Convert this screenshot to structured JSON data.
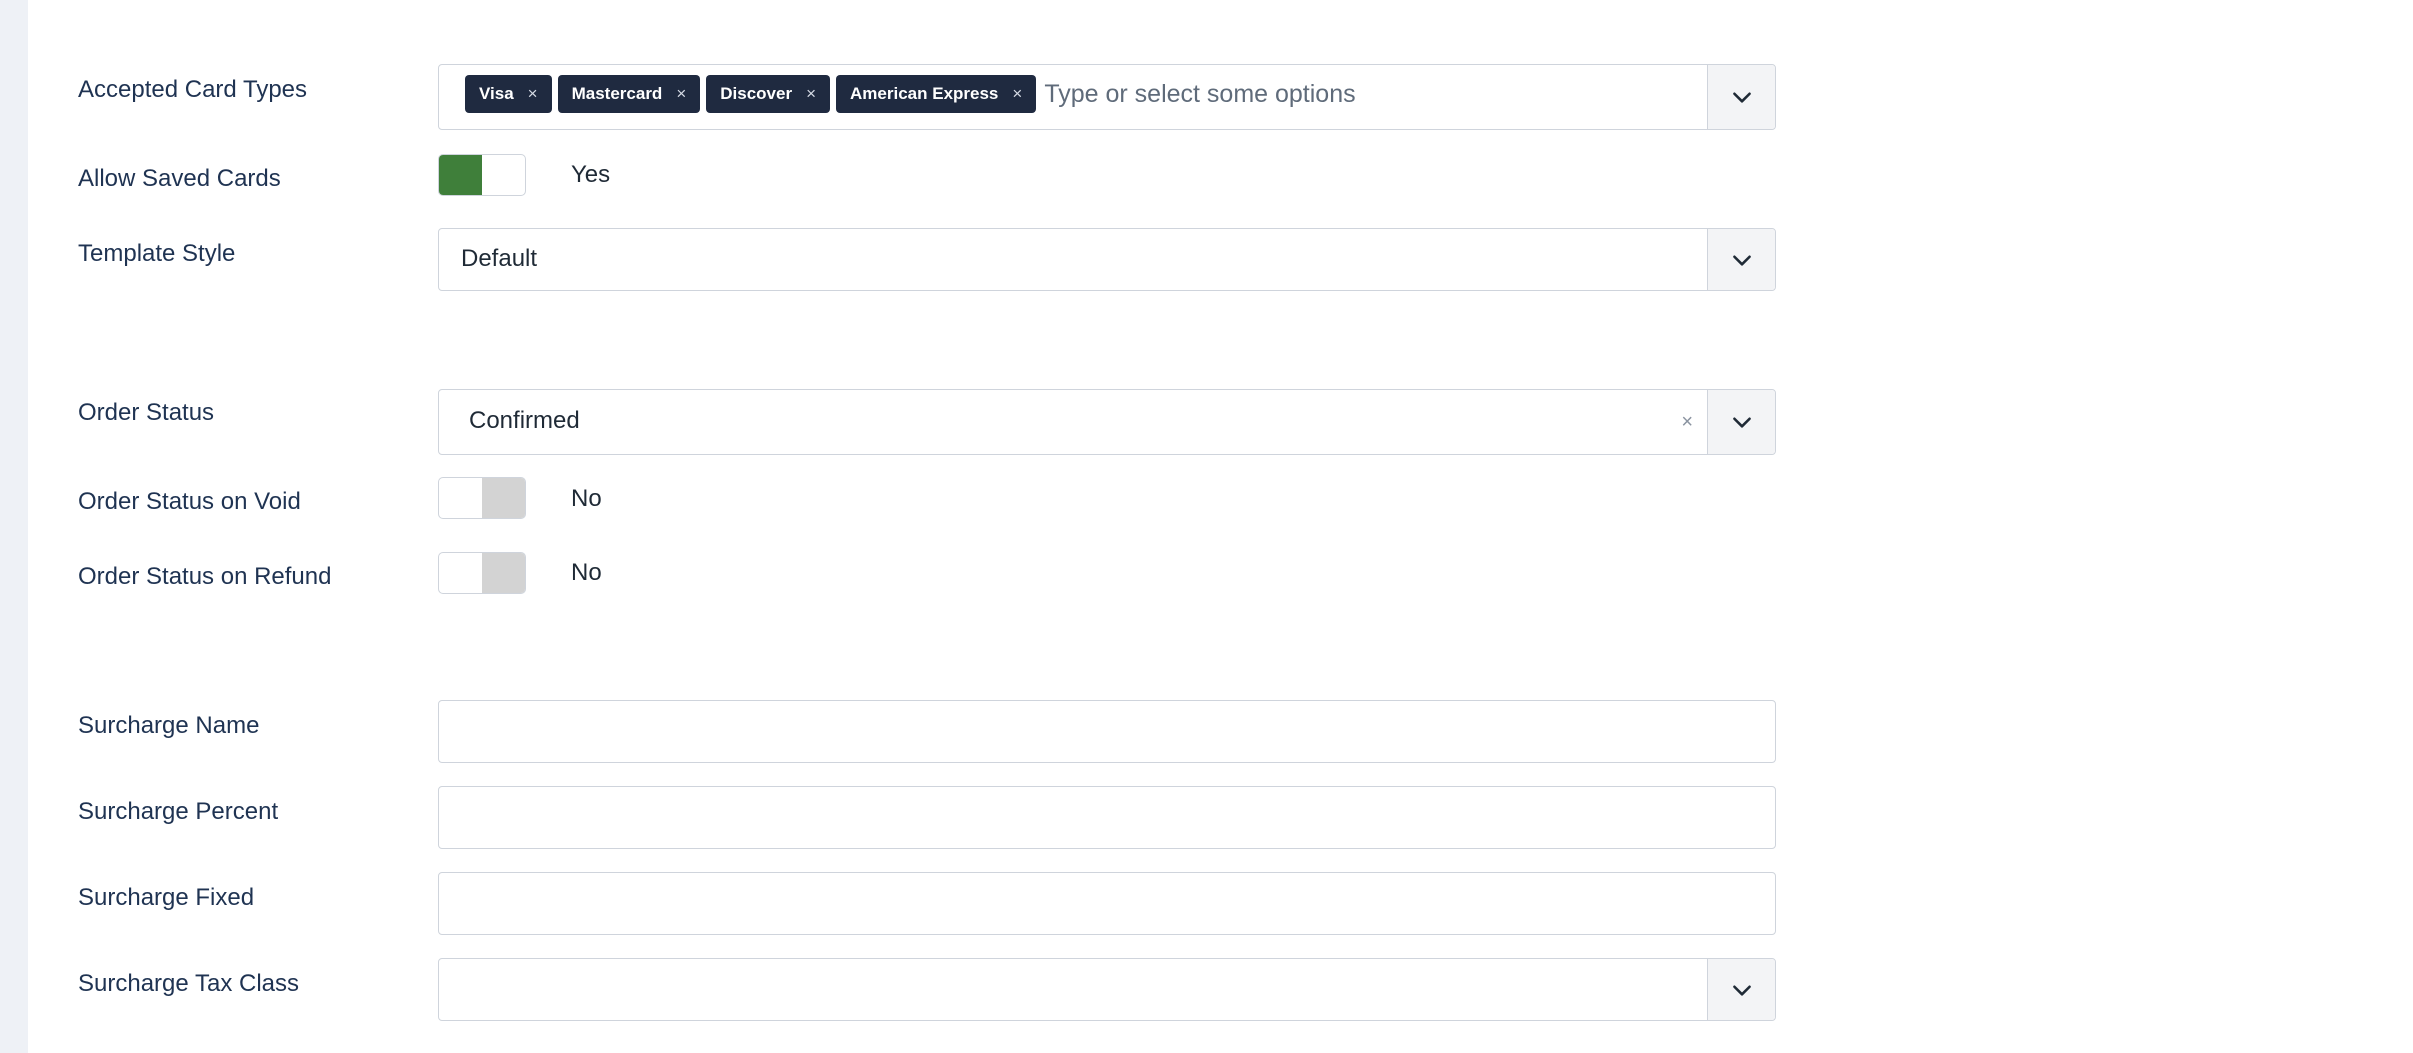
{
  "colors": {
    "page_bg": "#eef1f6",
    "panel_bg": "#ffffff",
    "tag_bg": "#1f2a40",
    "toggle_on": "#3f7f3a",
    "toggle_off": "#d3d3d3"
  },
  "accepted_card_types": {
    "label": "Accepted Card Types",
    "tags": [
      {
        "label": "Visa",
        "remove": "×"
      },
      {
        "label": "Mastercard",
        "remove": "×"
      },
      {
        "label": "Discover",
        "remove": "×"
      },
      {
        "label": "American Express",
        "remove": "×"
      }
    ],
    "placeholder": "Type or select some options",
    "icon": "chevron-down-icon"
  },
  "allow_saved_cards": {
    "label": "Allow Saved Cards",
    "state": "on",
    "value_text": "Yes"
  },
  "template_style": {
    "label": "Template Style",
    "value": "Default",
    "icon": "chevron-down-icon"
  },
  "order_status": {
    "label": "Order Status",
    "value": "Confirmed",
    "clear": "×",
    "icon": "chevron-down-icon"
  },
  "order_status_on_void": {
    "label": "Order Status on Void",
    "state": "off",
    "value_text": "No"
  },
  "order_status_on_refund": {
    "label": "Order Status on Refund",
    "state": "off",
    "value_text": "No"
  },
  "surcharge_name": {
    "label": "Surcharge Name",
    "value": ""
  },
  "surcharge_percent": {
    "label": "Surcharge Percent",
    "value": ""
  },
  "surcharge_fixed": {
    "label": "Surcharge Fixed",
    "value": ""
  },
  "surcharge_tax_class": {
    "label": "Surcharge Tax Class",
    "value": "",
    "icon": "chevron-down-icon"
  }
}
